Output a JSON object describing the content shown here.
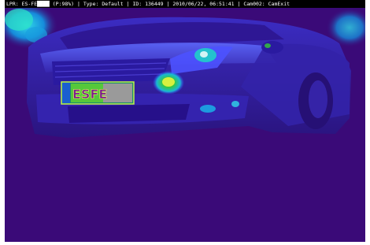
{
  "overlay": {
    "caption": "LPR: ES-FE████ (P:98%) | Type: Default | ID: 136449 | 2010/06/22, 06:51:41 | Cam002: CamExit"
  },
  "plate": {
    "visible_text": "ESFE"
  },
  "palette": {
    "background": "#3a0a78",
    "car_body": "#2d1fa0",
    "hot_spot": "#ffe600",
    "warm": "#36c936",
    "mid": "#19b8d6",
    "cool": "#3a50ff"
  }
}
